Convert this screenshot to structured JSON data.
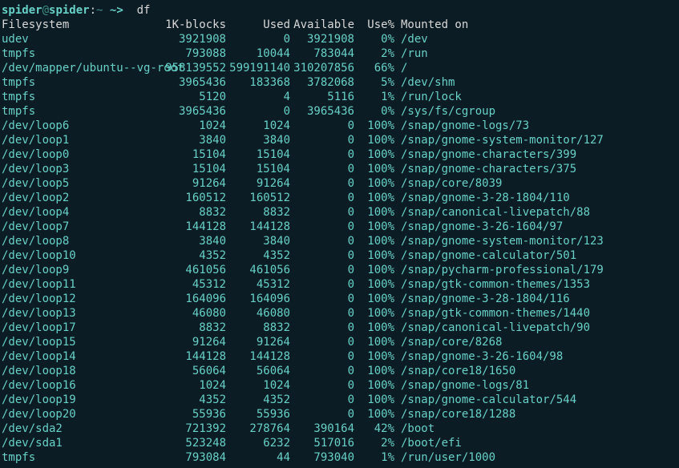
{
  "prompt": {
    "user": "spider",
    "host": "spider",
    "pathsep": ":",
    "tilde": "~",
    "arrow": "~>",
    "command": "df"
  },
  "header": {
    "fs": "Filesystem",
    "blocks": "1K-blocks",
    "used": "Used",
    "avail": "Available",
    "usepct": "Use%",
    "mounted": "Mounted on"
  },
  "rows": [
    {
      "fs": "udev",
      "blk": "3921908",
      "use": "0",
      "avl": "3921908",
      "pct": "0%",
      "mnt": "/dev"
    },
    {
      "fs": "tmpfs",
      "blk": "793088",
      "use": "10044",
      "avl": "783044",
      "pct": "2%",
      "mnt": "/run"
    },
    {
      "fs": "/dev/mapper/ubuntu--vg-root",
      "blk": "958139552",
      "use": "599191140",
      "avl": "310207856",
      "pct": "66%",
      "mnt": "/"
    },
    {
      "fs": "tmpfs",
      "blk": "3965436",
      "use": "183368",
      "avl": "3782068",
      "pct": "5%",
      "mnt": "/dev/shm"
    },
    {
      "fs": "tmpfs",
      "blk": "5120",
      "use": "4",
      "avl": "5116",
      "pct": "1%",
      "mnt": "/run/lock"
    },
    {
      "fs": "tmpfs",
      "blk": "3965436",
      "use": "0",
      "avl": "3965436",
      "pct": "0%",
      "mnt": "/sys/fs/cgroup"
    },
    {
      "fs": "/dev/loop6",
      "blk": "1024",
      "use": "1024",
      "avl": "0",
      "pct": "100%",
      "mnt": "/snap/gnome-logs/73"
    },
    {
      "fs": "/dev/loop1",
      "blk": "3840",
      "use": "3840",
      "avl": "0",
      "pct": "100%",
      "mnt": "/snap/gnome-system-monitor/127"
    },
    {
      "fs": "/dev/loop0",
      "blk": "15104",
      "use": "15104",
      "avl": "0",
      "pct": "100%",
      "mnt": "/snap/gnome-characters/399"
    },
    {
      "fs": "/dev/loop3",
      "blk": "15104",
      "use": "15104",
      "avl": "0",
      "pct": "100%",
      "mnt": "/snap/gnome-characters/375"
    },
    {
      "fs": "/dev/loop5",
      "blk": "91264",
      "use": "91264",
      "avl": "0",
      "pct": "100%",
      "mnt": "/snap/core/8039"
    },
    {
      "fs": "/dev/loop2",
      "blk": "160512",
      "use": "160512",
      "avl": "0",
      "pct": "100%",
      "mnt": "/snap/gnome-3-28-1804/110"
    },
    {
      "fs": "/dev/loop4",
      "blk": "8832",
      "use": "8832",
      "avl": "0",
      "pct": "100%",
      "mnt": "/snap/canonical-livepatch/88"
    },
    {
      "fs": "/dev/loop7",
      "blk": "144128",
      "use": "144128",
      "avl": "0",
      "pct": "100%",
      "mnt": "/snap/gnome-3-26-1604/97"
    },
    {
      "fs": "/dev/loop8",
      "blk": "3840",
      "use": "3840",
      "avl": "0",
      "pct": "100%",
      "mnt": "/snap/gnome-system-monitor/123"
    },
    {
      "fs": "/dev/loop10",
      "blk": "4352",
      "use": "4352",
      "avl": "0",
      "pct": "100%",
      "mnt": "/snap/gnome-calculator/501"
    },
    {
      "fs": "/dev/loop9",
      "blk": "461056",
      "use": "461056",
      "avl": "0",
      "pct": "100%",
      "mnt": "/snap/pycharm-professional/179"
    },
    {
      "fs": "/dev/loop11",
      "blk": "45312",
      "use": "45312",
      "avl": "0",
      "pct": "100%",
      "mnt": "/snap/gtk-common-themes/1353"
    },
    {
      "fs": "/dev/loop12",
      "blk": "164096",
      "use": "164096",
      "avl": "0",
      "pct": "100%",
      "mnt": "/snap/gnome-3-28-1804/116"
    },
    {
      "fs": "/dev/loop13",
      "blk": "46080",
      "use": "46080",
      "avl": "0",
      "pct": "100%",
      "mnt": "/snap/gtk-common-themes/1440"
    },
    {
      "fs": "/dev/loop17",
      "blk": "8832",
      "use": "8832",
      "avl": "0",
      "pct": "100%",
      "mnt": "/snap/canonical-livepatch/90"
    },
    {
      "fs": "/dev/loop15",
      "blk": "91264",
      "use": "91264",
      "avl": "0",
      "pct": "100%",
      "mnt": "/snap/core/8268"
    },
    {
      "fs": "/dev/loop14",
      "blk": "144128",
      "use": "144128",
      "avl": "0",
      "pct": "100%",
      "mnt": "/snap/gnome-3-26-1604/98"
    },
    {
      "fs": "/dev/loop18",
      "blk": "56064",
      "use": "56064",
      "avl": "0",
      "pct": "100%",
      "mnt": "/snap/core18/1650"
    },
    {
      "fs": "/dev/loop16",
      "blk": "1024",
      "use": "1024",
      "avl": "0",
      "pct": "100%",
      "mnt": "/snap/gnome-logs/81"
    },
    {
      "fs": "/dev/loop19",
      "blk": "4352",
      "use": "4352",
      "avl": "0",
      "pct": "100%",
      "mnt": "/snap/gnome-calculator/544"
    },
    {
      "fs": "/dev/loop20",
      "blk": "55936",
      "use": "55936",
      "avl": "0",
      "pct": "100%",
      "mnt": "/snap/core18/1288"
    },
    {
      "fs": "/dev/sda2",
      "blk": "721392",
      "use": "278764",
      "avl": "390164",
      "pct": "42%",
      "mnt": "/boot"
    },
    {
      "fs": "/dev/sda1",
      "blk": "523248",
      "use": "6232",
      "avl": "517016",
      "pct": "2%",
      "mnt": "/boot/efi"
    },
    {
      "fs": "tmpfs",
      "blk": "793084",
      "use": "44",
      "avl": "793040",
      "pct": "1%",
      "mnt": "/run/user/1000"
    }
  ]
}
